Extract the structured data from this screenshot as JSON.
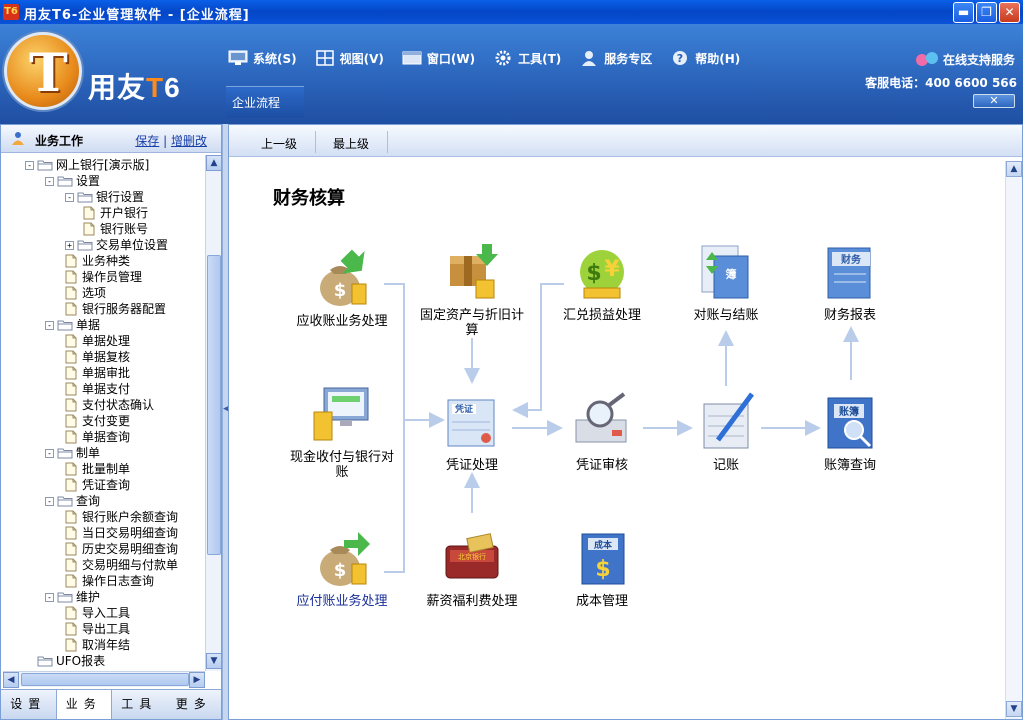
{
  "window": {
    "title": "用友T6-企业管理软件 - [企业流程]",
    "icon_label": "T6",
    "buttons": [
      "minimize",
      "restore",
      "close"
    ]
  },
  "brand": {
    "name": "用友",
    "suffix_t": "T",
    "suffix_6": "6"
  },
  "menu": [
    {
      "label": "系统(S)",
      "icon": "monitor-icon"
    },
    {
      "label": "视图(V)",
      "icon": "grid-icon"
    },
    {
      "label": "窗口(W)",
      "icon": "window-icon"
    },
    {
      "label": "工具(T)",
      "icon": "gear-icon"
    },
    {
      "label": "服务专区",
      "icon": "user-icon"
    },
    {
      "label": "帮助(H)",
      "icon": "help-icon"
    }
  ],
  "service": {
    "online": "在线支持服务",
    "phone": "客服电话：400 6600 566"
  },
  "tabs": [
    {
      "label": "企业流程"
    }
  ],
  "sidebar": {
    "title": "业务工作",
    "save_link": "保存",
    "edit_link": "增删改",
    "tree": [
      {
        "label": "网上银行[演示版]",
        "level": 0,
        "kind": "folder",
        "exp": "-"
      },
      {
        "label": "设置",
        "level": 1,
        "kind": "folder",
        "exp": "-"
      },
      {
        "label": "银行设置",
        "level": 2,
        "kind": "folder",
        "exp": "-"
      },
      {
        "label": "开户银行",
        "level": 3,
        "kind": "doc"
      },
      {
        "label": "银行账号",
        "level": 3,
        "kind": "doc"
      },
      {
        "label": "交易单位设置",
        "level": 2,
        "kind": "folder",
        "exp": "+"
      },
      {
        "label": "业务种类",
        "level": 2,
        "kind": "doc"
      },
      {
        "label": "操作员管理",
        "level": 2,
        "kind": "doc"
      },
      {
        "label": "选项",
        "level": 2,
        "kind": "doc"
      },
      {
        "label": "银行服务器配置",
        "level": 2,
        "kind": "doc"
      },
      {
        "label": "单据",
        "level": 1,
        "kind": "folder",
        "exp": "-"
      },
      {
        "label": "单据处理",
        "level": 2,
        "kind": "doc"
      },
      {
        "label": "单据复核",
        "level": 2,
        "kind": "doc"
      },
      {
        "label": "单据审批",
        "level": 2,
        "kind": "doc"
      },
      {
        "label": "单据支付",
        "level": 2,
        "kind": "doc"
      },
      {
        "label": "支付状态确认",
        "level": 2,
        "kind": "doc"
      },
      {
        "label": "支付变更",
        "level": 2,
        "kind": "doc"
      },
      {
        "label": "单据查询",
        "level": 2,
        "kind": "doc"
      },
      {
        "label": "制单",
        "level": 1,
        "kind": "folder",
        "exp": "-"
      },
      {
        "label": "批量制单",
        "level": 2,
        "kind": "doc"
      },
      {
        "label": "凭证查询",
        "level": 2,
        "kind": "doc"
      },
      {
        "label": "查询",
        "level": 1,
        "kind": "folder",
        "exp": "-"
      },
      {
        "label": "银行账户余额查询",
        "level": 2,
        "kind": "doc"
      },
      {
        "label": "当日交易明细查询",
        "level": 2,
        "kind": "doc"
      },
      {
        "label": "历史交易明细查询",
        "level": 2,
        "kind": "doc"
      },
      {
        "label": "交易明细与付款单",
        "level": 2,
        "kind": "doc"
      },
      {
        "label": "操作日志查询",
        "level": 2,
        "kind": "doc"
      },
      {
        "label": "维护",
        "level": 1,
        "kind": "folder",
        "exp": "-"
      },
      {
        "label": "导入工具",
        "level": 2,
        "kind": "doc"
      },
      {
        "label": "导出工具",
        "level": 2,
        "kind": "doc"
      },
      {
        "label": "取消年结",
        "level": 2,
        "kind": "doc"
      },
      {
        "label": "UFO报表",
        "level": 0,
        "kind": "folder",
        "exp": ""
      }
    ],
    "bottom_tabs": [
      "设置",
      "业务",
      "工具",
      "更多"
    ],
    "active_bottom_tab": 1
  },
  "nav": {
    "up": "上一级",
    "top": "最上级"
  },
  "flow": {
    "title": "财务核算",
    "items": [
      {
        "id": "ar",
        "label": "应收账业务处理",
        "icon": "money-bag-in-icon",
        "link": false
      },
      {
        "id": "fa",
        "label": "固定资产与折旧计算",
        "icon": "box-coins-icon",
        "link": false
      },
      {
        "id": "fx",
        "label": "汇兑损益处理",
        "icon": "currency-exchange-icon",
        "link": false
      },
      {
        "id": "rec",
        "label": "对账与结账",
        "icon": "ledger-book-icon",
        "link": false
      },
      {
        "id": "fr",
        "label": "财务报表",
        "icon": "report-book-icon",
        "link": false
      },
      {
        "id": "cash",
        "label": "现金收付与银行对账",
        "icon": "computer-coins-icon",
        "link": false
      },
      {
        "id": "vou",
        "label": "凭证处理",
        "icon": "voucher-icon",
        "link": false
      },
      {
        "id": "aud",
        "label": "凭证审核",
        "icon": "magnifier-document-icon",
        "link": false
      },
      {
        "id": "post",
        "label": "记账",
        "icon": "pen-ledger-icon",
        "link": false
      },
      {
        "id": "acq",
        "label": "账簿查询",
        "icon": "book-search-icon",
        "link": false
      },
      {
        "id": "ap",
        "label": "应付账业务处理",
        "icon": "money-bag-out-icon",
        "link": true
      },
      {
        "id": "pay",
        "label": "薪资福利费处理",
        "icon": "wallet-card-icon",
        "link": false
      },
      {
        "id": "cost",
        "label": "成本管理",
        "icon": "cost-book-icon",
        "link": false
      }
    ],
    "icon_text": {
      "voucher": "凭证",
      "finance": "财务",
      "book": "账簿",
      "cost": "成本",
      "wallet": "北京银行"
    }
  },
  "colors": {
    "accent": "#2a62b9",
    "title_bar": "#0a52d8",
    "arrow": "#b9cdea"
  }
}
